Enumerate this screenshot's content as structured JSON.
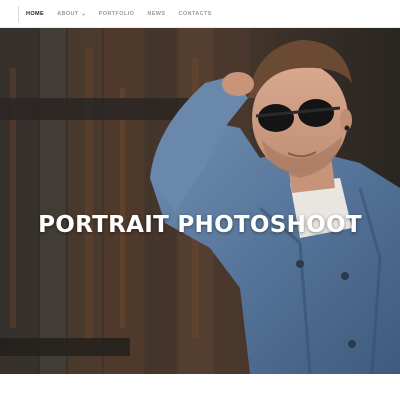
{
  "nav": {
    "items": [
      {
        "label": "HOME",
        "active": true,
        "has_dropdown": false
      },
      {
        "label": "ABOUT",
        "active": false,
        "has_dropdown": true
      },
      {
        "label": "PORTFOLIO",
        "active": false,
        "has_dropdown": false
      },
      {
        "label": "NEWS",
        "active": false,
        "has_dropdown": false
      },
      {
        "label": "CONTACTS",
        "active": false,
        "has_dropdown": false
      }
    ],
    "dropdown_icon": "chevron-down-icon"
  },
  "hero": {
    "title": "PORTRAIT PHOTOSHOOT",
    "image": "portrait-photo",
    "overlay_color": "#000000"
  },
  "colors": {
    "nav_active": "#222222",
    "nav_inactive": "#9a9a9a",
    "title": "#ffffff"
  }
}
